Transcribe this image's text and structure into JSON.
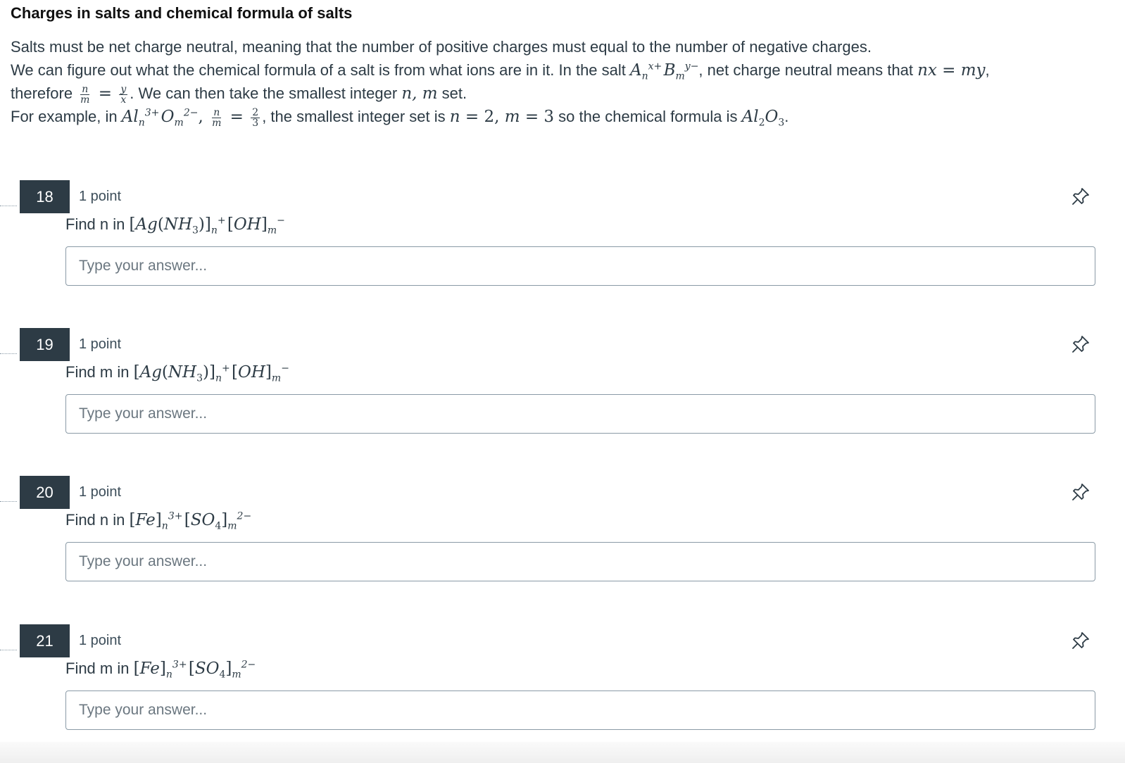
{
  "section": {
    "title": "Charges in salts and chemical formula of salts",
    "intro_line1": "Salts must be net charge neutral, meaning that the number of positive charges must equal to the number of negative charges.",
    "intro_line2_a": "We can figure out what the chemical formula of a salt is from what ions are in it. In the salt ",
    "intro_line2_b": ", net charge neutral means that ",
    "intro_line2_c": ",",
    "intro_line3_a": "therefore ",
    "intro_line3_b": ". We can then take the smallest integer ",
    "intro_line3_c": " set.",
    "intro_line4_a": "For example, in ",
    "intro_line4_b": ", the smallest integer set is ",
    "intro_line4_c": " so the chemical formula is ",
    "intro_line4_d": "."
  },
  "questions": [
    {
      "number": "18",
      "points": "1 point",
      "prompt_prefix": "Find n in ",
      "placeholder": "Type your answer..."
    },
    {
      "number": "19",
      "points": "1 point",
      "prompt_prefix": "Find m in ",
      "placeholder": "Type your answer..."
    },
    {
      "number": "20",
      "points": "1 point",
      "prompt_prefix": "Find n in ",
      "placeholder": "Type your answer..."
    },
    {
      "number": "21",
      "points": "1 point",
      "prompt_prefix": "Find m in ",
      "placeholder": "Type your answer..."
    }
  ],
  "icons": {
    "pin": "pin-icon"
  },
  "colors": {
    "number_badge_bg": "#2d3b45",
    "text": "#2d3b45",
    "input_border": "#8a9aa6"
  }
}
